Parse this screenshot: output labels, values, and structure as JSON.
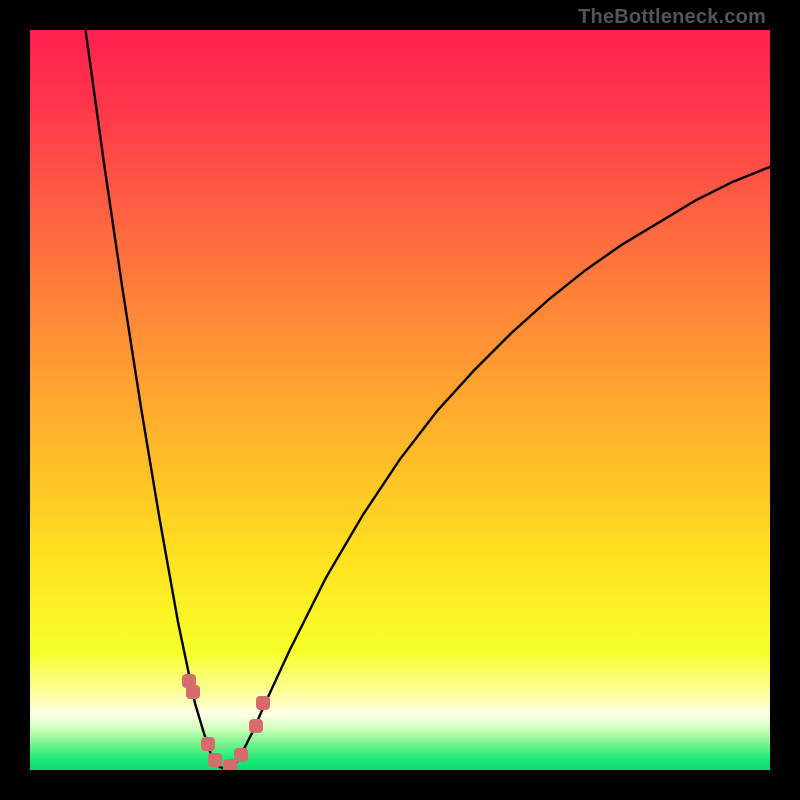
{
  "watermark": "TheBottleneck.com",
  "chart_data": {
    "type": "line",
    "title": "",
    "xlabel": "",
    "ylabel": "",
    "xlim": [
      0,
      100
    ],
    "ylim": [
      0,
      100
    ],
    "grid": false,
    "legend": false,
    "series": [
      {
        "name": "left-branch",
        "x": [
          7.5,
          10,
          12.5,
          15,
          17.5,
          20,
          22.3,
          23.5,
          24.5,
          25.5,
          26.5
        ],
        "y": [
          100,
          82,
          65,
          49,
          34,
          20,
          9,
          5,
          2,
          0.5,
          0
        ]
      },
      {
        "name": "right-branch",
        "x": [
          26.5,
          27.5,
          28.5,
          30,
          32,
          35,
          40,
          45,
          50,
          55,
          60,
          65,
          70,
          75,
          80,
          85,
          90,
          95,
          100
        ],
        "y": [
          0,
          0.5,
          2,
          5,
          9.5,
          16,
          26,
          34.5,
          42,
          48.5,
          54,
          59,
          63.5,
          67.5,
          71,
          74,
          77,
          79.5,
          81.5
        ]
      }
    ],
    "markers": {
      "name": "bottleneck-markers",
      "color": "#d66b6b",
      "points": [
        {
          "x": 21.5,
          "y": 12.0
        },
        {
          "x": 22.0,
          "y": 10.5
        },
        {
          "x": 24.0,
          "y": 3.5
        },
        {
          "x": 25.0,
          "y": 1.3
        },
        {
          "x": 27.0,
          "y": 0.5
        },
        {
          "x": 28.5,
          "y": 2.0
        },
        {
          "x": 30.5,
          "y": 6.0
        },
        {
          "x": 31.5,
          "y": 9.0
        }
      ]
    },
    "background_gradient": {
      "type": "vertical",
      "stops": [
        {
          "pos": 0.0,
          "color": "#ff1f4f"
        },
        {
          "pos": 0.12,
          "color": "#ff3b4a"
        },
        {
          "pos": 0.28,
          "color": "#ff6b3f"
        },
        {
          "pos": 0.45,
          "color": "#ff9a32"
        },
        {
          "pos": 0.6,
          "color": "#ffc227"
        },
        {
          "pos": 0.73,
          "color": "#ffe61f"
        },
        {
          "pos": 0.84,
          "color": "#f6ff2a"
        },
        {
          "pos": 0.905,
          "color": "#fbffb0"
        },
        {
          "pos": 0.925,
          "color": "#ffffe8"
        },
        {
          "pos": 0.945,
          "color": "#ccffb8"
        },
        {
          "pos": 0.965,
          "color": "#73f58a"
        },
        {
          "pos": 0.985,
          "color": "#20e878"
        },
        {
          "pos": 1.0,
          "color": "#0fdc6e"
        }
      ]
    }
  }
}
